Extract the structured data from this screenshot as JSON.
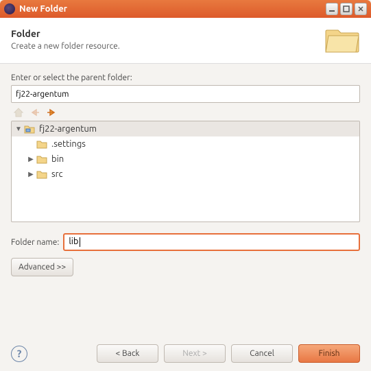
{
  "window": {
    "title": "New Folder"
  },
  "header": {
    "title": "Folder",
    "subtitle": "Create a new folder resource."
  },
  "parent": {
    "label": "Enter or select the parent folder:",
    "value": "fj22-argentum"
  },
  "tree": {
    "root": {
      "name": "fj22-argentum",
      "expanded": true,
      "children": [
        {
          "name": ".settings",
          "expandable": false
        },
        {
          "name": "bin",
          "expandable": true
        },
        {
          "name": "src",
          "expandable": true
        }
      ]
    }
  },
  "folder_name": {
    "label": "Folder name:",
    "value": "lib"
  },
  "buttons": {
    "advanced": "Advanced >>",
    "back": "< Back",
    "next": "Next >",
    "cancel": "Cancel",
    "finish": "Finish"
  },
  "icons": {
    "home": "home-icon",
    "back": "back-arrow-icon",
    "forward": "forward-arrow-icon"
  }
}
